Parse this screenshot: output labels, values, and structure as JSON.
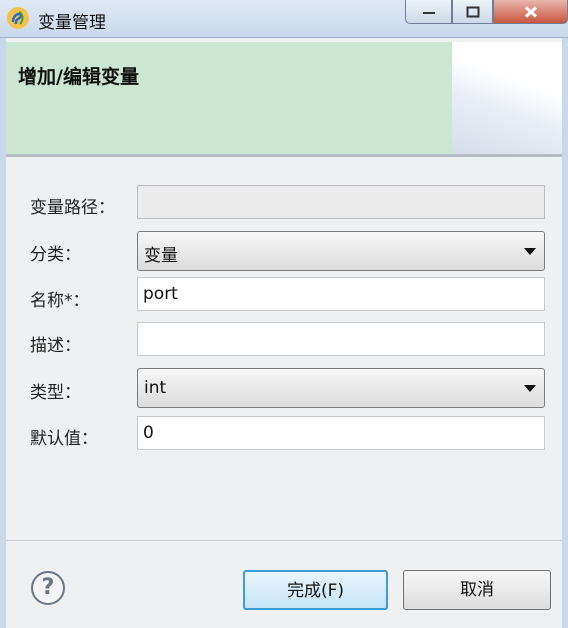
{
  "window": {
    "title": "变量管理",
    "icon": "app-logo-icon",
    "controls": [
      "minimize-icon",
      "maximize-icon",
      "close-icon"
    ]
  },
  "banner": {
    "title": "增加/编辑变量"
  },
  "form": {
    "path_label": "变量路径：",
    "path_value": "",
    "category_label": "分类：",
    "category_value": "变量",
    "name_label": "名称*：",
    "name_value": "port",
    "desc_label": "描述：",
    "desc_value": "",
    "type_label": "类型：",
    "type_value": "int",
    "default_label": "默认值：",
    "default_value": "0"
  },
  "footer": {
    "help_symbol": "?",
    "finish_label": "完成(F)",
    "cancel_label": "取消"
  },
  "colors": {
    "banner_bg": "#cbe6d2",
    "primary_border": "#3c9bd8",
    "close_button": "#c8553f"
  }
}
